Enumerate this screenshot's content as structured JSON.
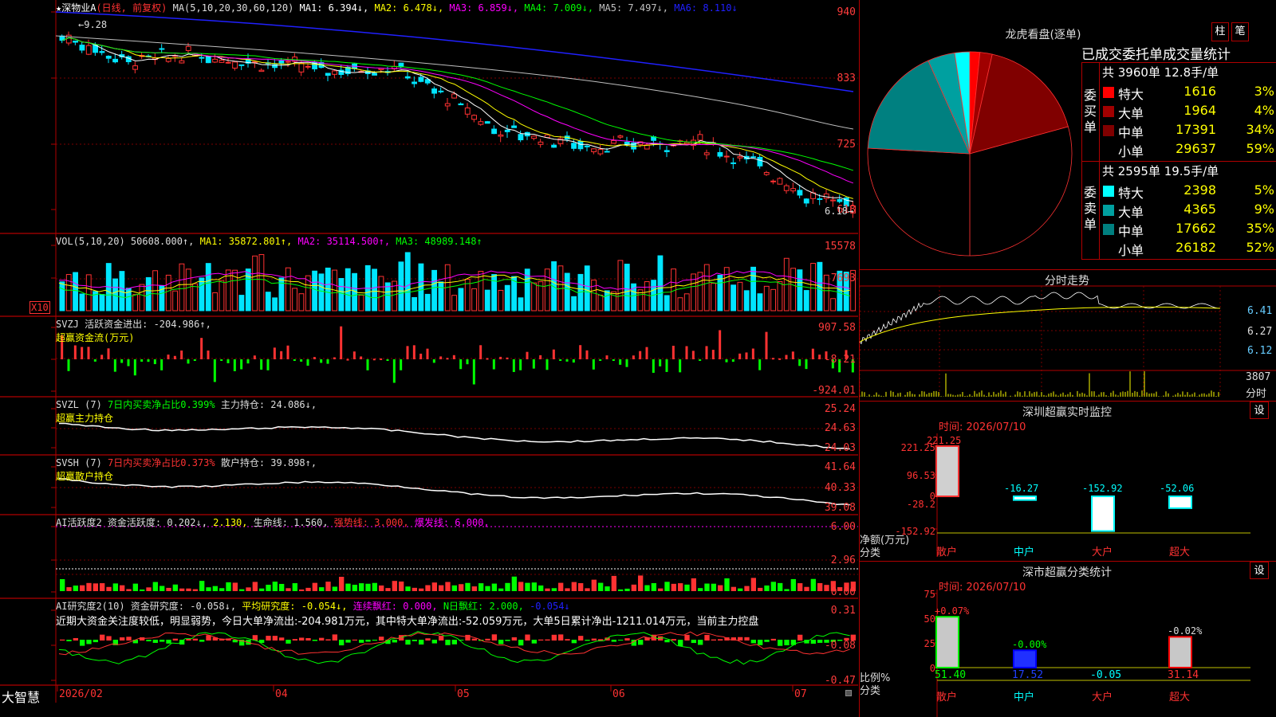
{
  "colors": {
    "up": "#ff3232",
    "down": "#00e5ff",
    "bg": "#000000",
    "frame": "#b00000",
    "ma1": "#ffffff",
    "ma2": "#ffff00",
    "ma3": "#ff00ff",
    "ma4": "#00ff00",
    "ma5": "#c0c0c0",
    "ma6": "#2020ff"
  },
  "brand": "大智慧",
  "price": {
    "legend": {
      "name": "★深物业A",
      "mode": "(日线, 前复权)",
      "ma": "MA(5,10,20,30,60,120)",
      "ma1": "MA1: 6.394↓,",
      "ma2": "MA2: 6.478↓,",
      "ma3": "MA3: 6.859↓,",
      "ma4": "MA4: 7.009↓,",
      "ma5": "MA5: 7.497↓,",
      "ma6": "MA6: 8.110↓"
    },
    "axis": [
      "940",
      "833",
      "725",
      "618"
    ],
    "high_label": "9.28",
    "low_label": "6.18"
  },
  "volume": {
    "legend": {
      "a": "VOL(5,10,20)  50608.000↑,",
      "b": "MA1: 35872.801↑,",
      "c": "MA2: 35114.500↑,",
      "d": "MA3: 48989.148↑"
    },
    "axis": [
      "15578",
      "7693"
    ],
    "unit": "X10"
  },
  "svzj": {
    "legend": {
      "a": "SVZJ  活跃资金进出: -204.986↑,",
      "b": "超赢资金流(万元)"
    },
    "axis": [
      "907.58",
      "-8.21",
      "-924.01"
    ]
  },
  "svzl": {
    "legend": {
      "a": "SVZL (7)",
      "b": "7日内买卖净占比0.399%",
      "c": "主力持仓: 24.086↓,",
      "d": "超赢主力持仓"
    },
    "axis": [
      "25.24",
      "24.63",
      "24.03"
    ]
  },
  "svsh": {
    "legend": {
      "a": "SVSH (7)",
      "b": "7日内买卖净占比0.373%",
      "c": "散户持仓: 39.898↑,",
      "d": "超赢散户持仓"
    },
    "axis": [
      "41.64",
      "40.33",
      "39.08"
    ]
  },
  "ai1": {
    "legend": {
      "a": "AI活跃度2  资金活跃度: 0.202↓,",
      "b": "2.130,",
      "c": "生命线: 1.560,",
      "d": "强势线: 3.000,",
      "e": "爆发线: 6.000,"
    },
    "axis": [
      "6.00",
      "2.96",
      "0.00"
    ]
  },
  "ai2": {
    "legend": {
      "a": "AI研究度2(10)  资金研究度: -0.058↓,",
      "b": "平均研究度: -0.054↓,",
      "c": "连续飘红: 0.000,",
      "d": "N日飘红: 2.000,",
      "e": "-0.054↓"
    },
    "comment": "近期大资金关注度较低，明显弱势，今日大单净流出:-204.981万元，其中特大单净流出:-52.059万元，大单5日累计净出-1211.014万元，当前主力控盘",
    "axis": [
      "0.31",
      "-0.08",
      "-0.47"
    ]
  },
  "date_axis": [
    "2026/02",
    "04",
    "05",
    "06",
    "07"
  ],
  "lhb": {
    "title": "龙虎看盘(逐单)",
    "btn1": "柱",
    "btn2": "笔",
    "stats_title": "已成交委托单成交量统计",
    "buy": {
      "side": "委买单",
      "summary": "共 3960单 12.8手/单",
      "rows": [
        {
          "label": "特大",
          "value": "1616",
          "pct": "3%",
          "color": "#ff0000"
        },
        {
          "label": "大单",
          "value": "1964",
          "pct": "4%",
          "color": "#a00000"
        },
        {
          "label": "中单",
          "value": "17391",
          "pct": "34%",
          "color": "#800000"
        },
        {
          "label": "小单",
          "value": "29637",
          "pct": "59%",
          "color": ""
        }
      ]
    },
    "sell": {
      "side": "委卖单",
      "summary": "共 2595单 19.5手/单",
      "rows": [
        {
          "label": "特大",
          "value": "2398",
          "pct": "5%",
          "color": "#00ffff"
        },
        {
          "label": "大单",
          "value": "4365",
          "pct": "9%",
          "color": "#00a0a0"
        },
        {
          "label": "中单",
          "value": "17662",
          "pct": "35%",
          "color": "#008080"
        },
        {
          "label": "小单",
          "value": "26182",
          "pct": "52%",
          "color": ""
        }
      ]
    }
  },
  "intraday": {
    "title": "分时走势",
    "axis": [
      "6.41",
      "6.27",
      "6.12"
    ],
    "vol_axis": "3807",
    "vol_unit": "分时"
  },
  "monitor": {
    "title": "深圳超赢实时监控",
    "btn": "设",
    "time": "时间: 2026/07/10",
    "axis": [
      "221.25",
      "96.53",
      "0",
      "-28.2",
      "-152.92"
    ],
    "ylabel": "净额(万元)",
    "xlabel": "分类",
    "cats": [
      "散户",
      "中户",
      "大户",
      "超大"
    ],
    "values": [
      "221.25",
      "-16.27",
      "-152.92",
      "-52.06"
    ]
  },
  "classify": {
    "title": "深市超赢分类统计",
    "btn": "设",
    "time": "时间: 2026/07/10",
    "axis": [
      "75",
      "50",
      "25",
      "0"
    ],
    "ylabel": "比例%",
    "xlabel": "分类",
    "cats": [
      "散户",
      "中户",
      "大户",
      "超大"
    ],
    "top": [
      "+0.07%",
      "-0.00%",
      "",
      "-0.02%"
    ],
    "bottom": [
      "51.40",
      "17.52",
      "-0.05",
      "31.14"
    ]
  }
}
